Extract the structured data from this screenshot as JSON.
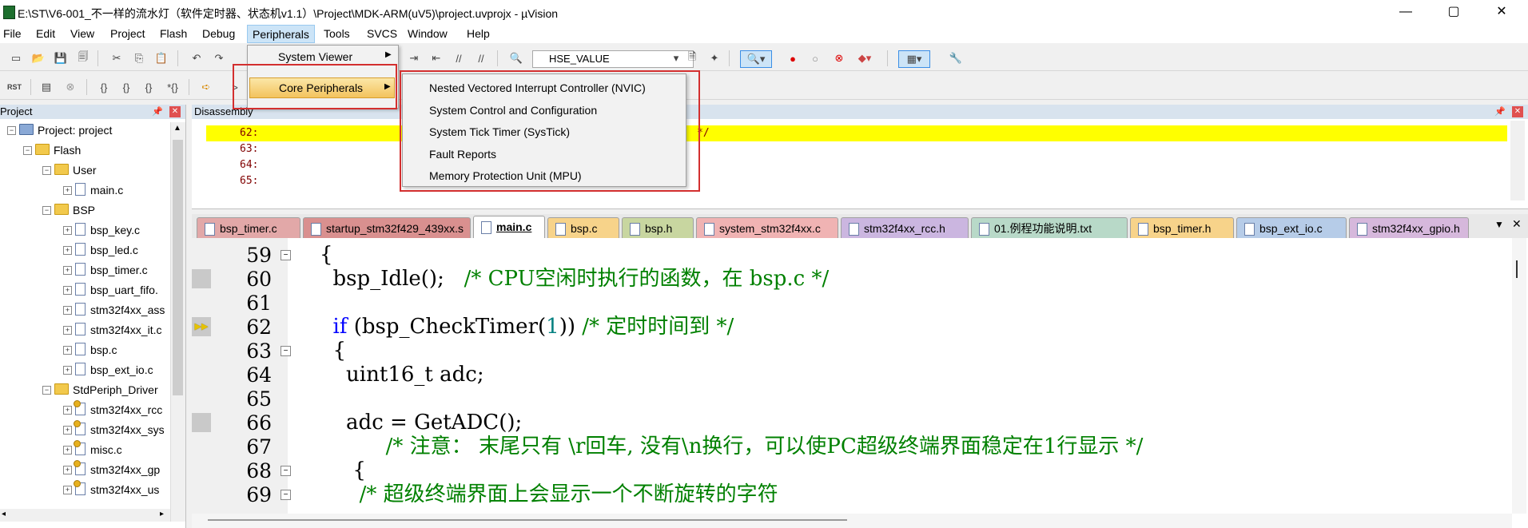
{
  "window": {
    "title": "E:\\ST\\V6-001_不一样的流水灯（软件定时器、状态机v1.1）\\Project\\MDK-ARM(uV5)\\project.uvprojx - µVision",
    "minimize": "—",
    "maximize": "▢",
    "close": "✕"
  },
  "menubar": {
    "items": [
      "File",
      "Edit",
      "View",
      "Project",
      "Flash",
      "Debug",
      "Peripherals",
      "Tools",
      "SVCS",
      "Window",
      "Help"
    ]
  },
  "toolbar": {
    "combo_value": "HSE_VALUE",
    "rst_label": "RST"
  },
  "peripherals_menu": {
    "items": [
      "System Viewer",
      "Core Peripherals"
    ]
  },
  "core_submenu": {
    "items": [
      "Nested Vectored Interrupt Controller (NVIC)",
      "System Control and Configuration",
      "System Tick Timer (SysTick)",
      "Fault Reports",
      "Memory Protection Unit (MPU)"
    ]
  },
  "project_panel": {
    "title": "Project",
    "pin": "📌",
    "close": "✕",
    "tree": [
      {
        "label": "Project: project",
        "level": 0,
        "type": "project",
        "exp": "−"
      },
      {
        "label": "Flash",
        "level": 1,
        "type": "folder",
        "exp": "−"
      },
      {
        "label": "User",
        "level": 2,
        "type": "folder",
        "exp": "−"
      },
      {
        "label": "main.c",
        "level": 3,
        "type": "file",
        "exp": "+"
      },
      {
        "label": "BSP",
        "level": 2,
        "type": "folder",
        "exp": "−"
      },
      {
        "label": "bsp_key.c",
        "level": 3,
        "type": "file",
        "exp": "+"
      },
      {
        "label": "bsp_led.c",
        "level": 3,
        "type": "file",
        "exp": "+"
      },
      {
        "label": "bsp_timer.c",
        "level": 3,
        "type": "file",
        "exp": "+"
      },
      {
        "label": "bsp_uart_fifo.",
        "level": 3,
        "type": "file",
        "exp": "+"
      },
      {
        "label": "stm32f4xx_ass",
        "level": 3,
        "type": "file",
        "exp": "+"
      },
      {
        "label": "stm32f4xx_it.c",
        "level": 3,
        "type": "file",
        "exp": "+"
      },
      {
        "label": "bsp.c",
        "level": 3,
        "type": "file",
        "exp": "+"
      },
      {
        "label": "bsp_ext_io.c",
        "level": 3,
        "type": "file",
        "exp": "+"
      },
      {
        "label": "StdPeriph_Driver",
        "level": 2,
        "type": "folder",
        "exp": "−"
      },
      {
        "label": "stm32f4xx_rcc",
        "level": 3,
        "type": "key",
        "exp": "+"
      },
      {
        "label": "stm32f4xx_sys",
        "level": 3,
        "type": "key",
        "exp": "+"
      },
      {
        "label": "misc.c",
        "level": 3,
        "type": "key",
        "exp": "+"
      },
      {
        "label": "stm32f4xx_gp",
        "level": 3,
        "type": "key",
        "exp": "+"
      },
      {
        "label": "stm32f4xx_us",
        "level": 3,
        "type": "key",
        "exp": "+"
      }
    ]
  },
  "disassembly": {
    "title": "Disassembly",
    "lines": [
      "62:",
      "63:",
      "64:",
      "65:"
    ],
    "comment_tail": "*/"
  },
  "tabs": [
    {
      "label": "bsp_timer.c",
      "bg": "#e2a8a8",
      "active": false
    },
    {
      "label": "startup_stm32f429_439xx.s",
      "bg": "#d9908f",
      "active": false
    },
    {
      "label": "main.c",
      "bg": "#ffffff",
      "active": true
    },
    {
      "label": "bsp.c",
      "bg": "#f7d38a",
      "active": false
    },
    {
      "label": "bsp.h",
      "bg": "#c8d6a0",
      "active": false
    },
    {
      "label": "system_stm32f4xx.c",
      "bg": "#f0b3b3",
      "active": false
    },
    {
      "label": "stm32f4xx_rcc.h",
      "bg": "#cbb6e0",
      "active": false
    },
    {
      "label": "01.例程功能说明.txt",
      "bg": "#b8d9c8",
      "active": false
    },
    {
      "label": "bsp_timer.h",
      "bg": "#f7d38a",
      "active": false
    },
    {
      "label": "bsp_ext_io.c",
      "bg": "#b6cce8",
      "active": false
    },
    {
      "label": "stm32f4xx_gpio.h",
      "bg": "#d6b8dc",
      "active": false
    }
  ],
  "editor": {
    "lines": [
      {
        "num": "59",
        "fold": "−",
        "marker": ""
      },
      {
        "num": "60",
        "fold": "",
        "marker": "gray"
      },
      {
        "num": "61",
        "fold": "",
        "marker": ""
      },
      {
        "num": "62",
        "fold": "",
        "marker": "arrow"
      },
      {
        "num": "63",
        "fold": "−",
        "marker": ""
      },
      {
        "num": "64",
        "fold": "",
        "marker": ""
      },
      {
        "num": "65",
        "fold": "",
        "marker": ""
      },
      {
        "num": "66",
        "fold": "",
        "marker": "gray"
      },
      {
        "num": "67",
        "fold": "",
        "marker": ""
      },
      {
        "num": "68",
        "fold": "−",
        "marker": ""
      },
      {
        "num": "69",
        "fold": "−",
        "marker": ""
      }
    ],
    "code": {
      "l59": "{",
      "l60_code": "  bsp_Idle();   ",
      "l60_cm": "/* CPU空闲时执行的函数，在 bsp.c */",
      "l62_kw": "if",
      "l62_a": " (bsp_CheckTimer(",
      "l62_num": "1",
      "l62_b": ")) ",
      "l62_cm": "/* 定时时间到 */",
      "l63": "  {",
      "l64": "    uint16_t adc;",
      "l66": "    adc = GetADC();",
      "l67_cm": "/* 注意： 末尾只有 \\r回车, 没有\\n换行，可以使PC超级终端界面稳定在1行显示 */",
      "l68": "     {",
      "l69_cm": "/* 超级终端界面上会显示一个不断旋转的字符"
    }
  },
  "colors": {
    "highlight": "#ffff00",
    "keyword": "#0000ff",
    "comment": "#008000",
    "annotation": "#d32f2f"
  }
}
